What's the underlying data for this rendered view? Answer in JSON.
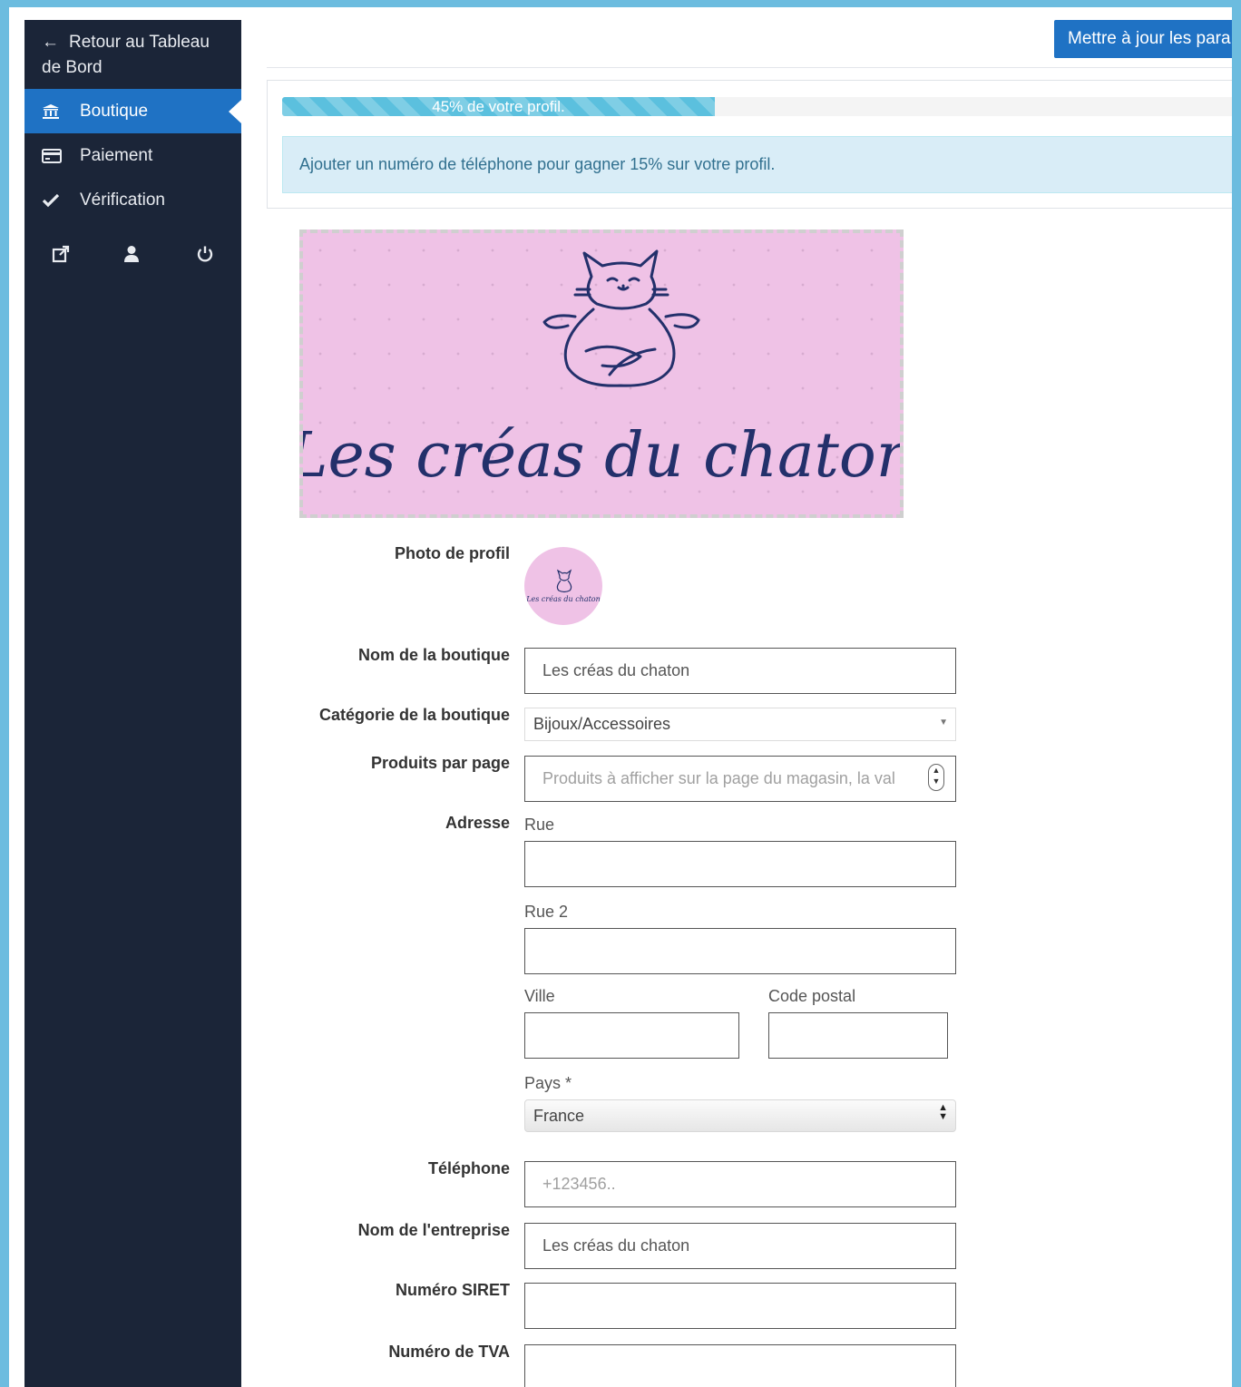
{
  "sidebar": {
    "back_label": "Retour au Tableau de Bord",
    "items": [
      {
        "label": "Boutique",
        "icon": "bank-icon",
        "active": true
      },
      {
        "label": "Paiement",
        "icon": "credit-card-icon",
        "active": false
      },
      {
        "label": "Vérification",
        "icon": "check-icon",
        "active": false
      }
    ],
    "bottom_icons": [
      "external-link-icon",
      "user-icon",
      "power-icon"
    ]
  },
  "header": {
    "update_button": "Mettre à jour les para"
  },
  "profile": {
    "progress_value": 45,
    "progress_text": "45% de votre profil.",
    "alert_text": "Ajouter un numéro de téléphone pour gagner 15% sur votre profil."
  },
  "banner": {
    "logo_text": "Les créas du chaton",
    "background_color": "#efc2e6",
    "ink_color": "#23306b"
  },
  "form": {
    "photo_label": "Photo de profil",
    "shop_name_label": "Nom de la boutique",
    "shop_name_value": "Les créas du chaton",
    "category_label": "Catégorie de la boutique",
    "category_value": "Bijoux/Accessoires",
    "products_label": "Produits par page",
    "products_placeholder": "Produits à afficher sur la page du magasin, la val",
    "address_label": "Adresse",
    "street_label": "Rue",
    "street2_label": "Rue 2",
    "city_label": "Ville",
    "zip_label": "Code postal",
    "country_label": "Pays *",
    "country_value": "France",
    "phone_label": "Téléphone",
    "phone_placeholder": "+123456..",
    "company_label": "Nom de l'entreprise",
    "company_value": "Les créas du chaton",
    "siret_label": "Numéro SIRET",
    "vat_label": "Numéro de TVA"
  },
  "colors": {
    "sidebar_bg": "#1b2538",
    "accent": "#1f72c4",
    "progress": "#5bc0de",
    "alert_bg": "#d9edf7",
    "alert_text": "#31708f"
  }
}
